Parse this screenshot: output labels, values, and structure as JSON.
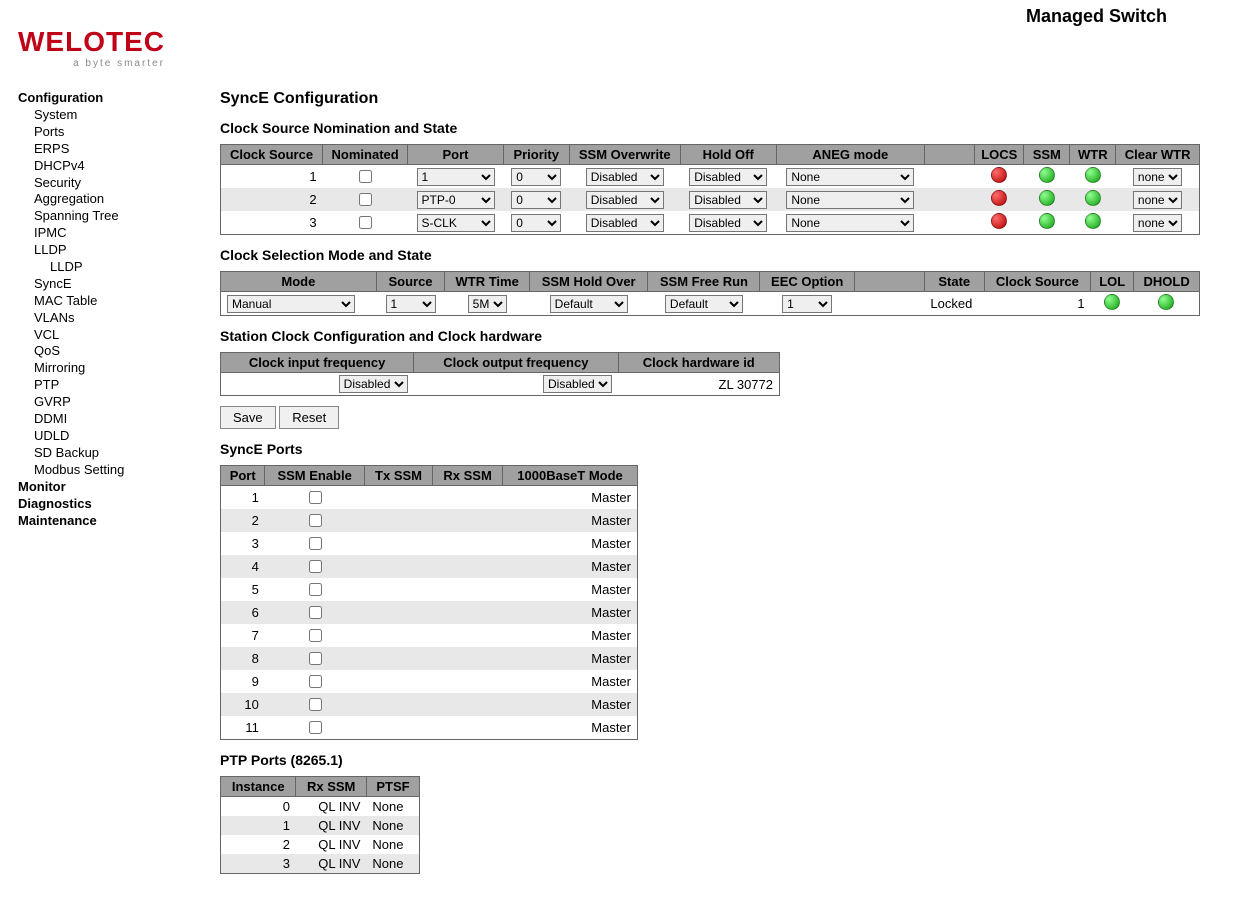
{
  "header": {
    "product_title": "Managed Switch",
    "logo_main": "WELOTEC",
    "logo_tag": "a byte smarter"
  },
  "sidebar": {
    "sections": [
      {
        "label": "Configuration",
        "bold": true
      },
      {
        "label": "System"
      },
      {
        "label": "Ports"
      },
      {
        "label": "ERPS"
      },
      {
        "label": "DHCPv4"
      },
      {
        "label": "Security"
      },
      {
        "label": "Aggregation"
      },
      {
        "label": "Spanning Tree"
      },
      {
        "label": "IPMC"
      },
      {
        "label": "LLDP"
      },
      {
        "label": "LLDP",
        "sub": true
      },
      {
        "label": "SyncE"
      },
      {
        "label": "MAC Table"
      },
      {
        "label": "VLANs"
      },
      {
        "label": "VCL"
      },
      {
        "label": "QoS"
      },
      {
        "label": "Mirroring"
      },
      {
        "label": "PTP"
      },
      {
        "label": "GVRP"
      },
      {
        "label": "DDMI"
      },
      {
        "label": "UDLD"
      },
      {
        "label": "SD Backup"
      },
      {
        "label": "Modbus Setting"
      },
      {
        "label": "Monitor",
        "bold": true
      },
      {
        "label": "Diagnostics",
        "bold": true
      },
      {
        "label": "Maintenance",
        "bold": true
      }
    ]
  },
  "main": {
    "title": "SyncE Configuration",
    "nomination": {
      "title": "Clock Source Nomination and State",
      "headers": [
        "Clock Source",
        "Nominated",
        "Port",
        "Priority",
        "SSM Overwrite",
        "Hold Off",
        "ANEG mode",
        "",
        "LOCS",
        "SSM",
        "WTR",
        "Clear WTR"
      ],
      "rows": [
        {
          "source": "1",
          "port": "1",
          "priority": "0",
          "ssm_overwrite": "Disabled",
          "hold_off": "Disabled",
          "aneg": "None",
          "locs": "red",
          "ssm": "green",
          "wtr": "green",
          "clear": "none"
        },
        {
          "source": "2",
          "port": "PTP-0",
          "priority": "0",
          "ssm_overwrite": "Disabled",
          "hold_off": "Disabled",
          "aneg": "None",
          "locs": "red",
          "ssm": "green",
          "wtr": "green",
          "clear": "none"
        },
        {
          "source": "3",
          "port": "S-CLK",
          "priority": "0",
          "ssm_overwrite": "Disabled",
          "hold_off": "Disabled",
          "aneg": "None",
          "locs": "red",
          "ssm": "green",
          "wtr": "green",
          "clear": "none"
        }
      ]
    },
    "selection": {
      "title": "Clock Selection Mode and State",
      "headers": [
        "Mode",
        "Source",
        "WTR Time",
        "SSM Hold Over",
        "SSM Free Run",
        "EEC Option",
        "",
        "State",
        "Clock Source",
        "LOL",
        "DHOLD"
      ],
      "row": {
        "mode": "Manual",
        "source": "1",
        "wtr_time": "5M",
        "ssm_hold_over": "Default",
        "ssm_free_run": "Default",
        "eec_option": "1",
        "state": "Locked",
        "clock_source": "1",
        "lol": "green",
        "dhold": "green"
      }
    },
    "station": {
      "title": "Station Clock Configuration and Clock hardware",
      "headers": [
        "Clock input frequency",
        "Clock output frequency",
        "Clock hardware id"
      ],
      "row": {
        "clock_in": "Disabled",
        "clock_out": "Disabled",
        "hw_id": "ZL 30772"
      }
    },
    "buttons": {
      "save": "Save",
      "reset": "Reset"
    },
    "ports": {
      "title": "SyncE Ports",
      "headers": [
        "Port",
        "SSM Enable",
        "Tx SSM",
        "Rx SSM",
        "1000BaseT Mode"
      ],
      "rows": [
        {
          "port": "1",
          "mode": "Master"
        },
        {
          "port": "2",
          "mode": "Master"
        },
        {
          "port": "3",
          "mode": "Master"
        },
        {
          "port": "4",
          "mode": "Master"
        },
        {
          "port": "5",
          "mode": "Master"
        },
        {
          "port": "6",
          "mode": "Master"
        },
        {
          "port": "7",
          "mode": "Master"
        },
        {
          "port": "8",
          "mode": "Master"
        },
        {
          "port": "9",
          "mode": "Master"
        },
        {
          "port": "10",
          "mode": "Master"
        },
        {
          "port": "11",
          "mode": "Master"
        }
      ]
    },
    "ptp": {
      "title": "PTP Ports (8265.1)",
      "headers": [
        "Instance",
        "Rx SSM",
        "PTSF"
      ],
      "rows": [
        {
          "inst": "0",
          "rx": "QL INV",
          "ptsf": "None"
        },
        {
          "inst": "1",
          "rx": "QL INV",
          "ptsf": "None"
        },
        {
          "inst": "2",
          "rx": "QL INV",
          "ptsf": "None"
        },
        {
          "inst": "3",
          "rx": "QL INV",
          "ptsf": "None"
        }
      ]
    }
  }
}
